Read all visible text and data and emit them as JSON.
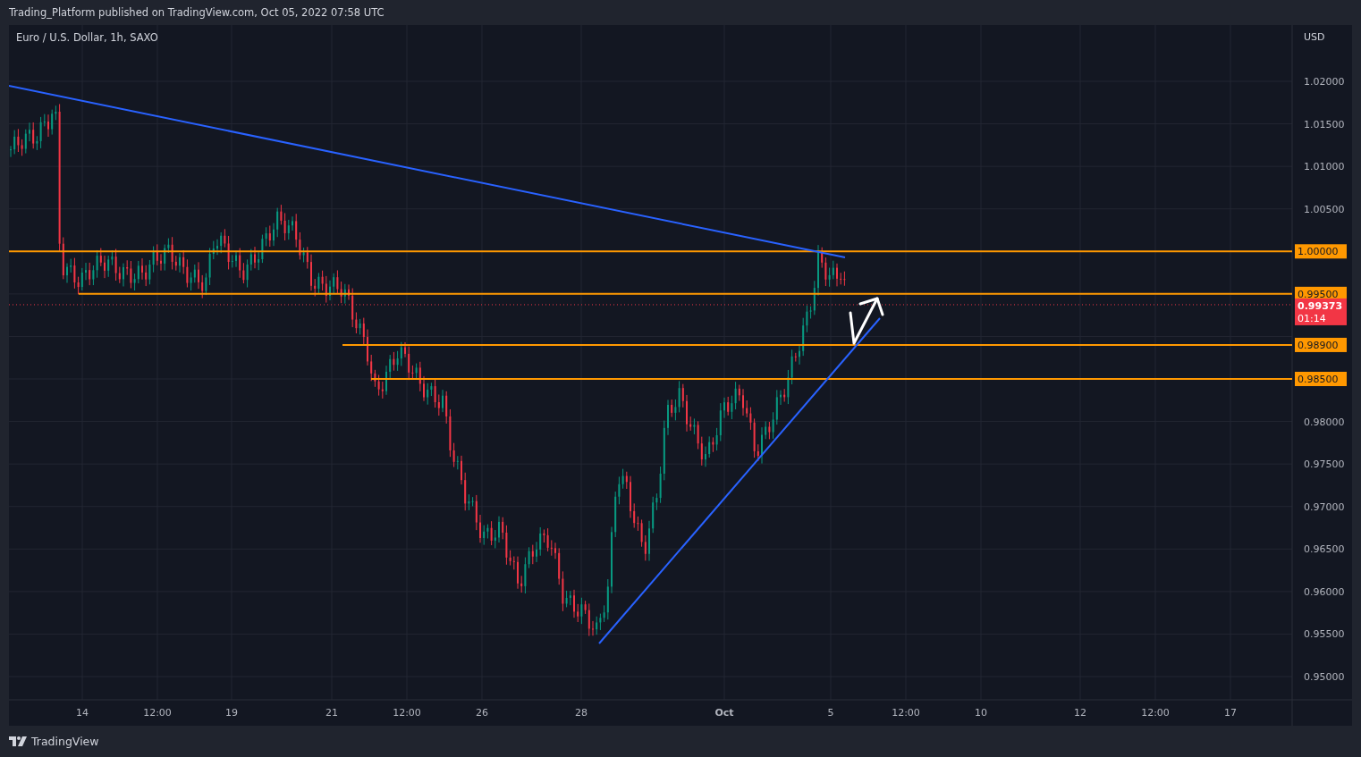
{
  "header": {
    "published_line": "Trading_Platform published on TradingView.com, Oct 05, 2022 07:58 UTC"
  },
  "chart": {
    "symbol_title": "Euro / U.S. Dollar, 1h, SAXO"
  },
  "price_axis": {
    "currency": "USD",
    "ticks": [
      {
        "label": "1.02000"
      },
      {
        "label": "1.01500"
      },
      {
        "label": "1.01000"
      },
      {
        "label": "1.00500"
      },
      {
        "label": "0.98000"
      },
      {
        "label": "0.97500"
      },
      {
        "label": "0.97000"
      },
      {
        "label": "0.96500"
      },
      {
        "label": "0.96000"
      },
      {
        "label": "0.95500"
      },
      {
        "label": "0.95000"
      }
    ],
    "levels": [
      {
        "label": "1.00000"
      },
      {
        "label": "0.99500"
      },
      {
        "label": "0.98900"
      },
      {
        "label": "0.98500"
      }
    ],
    "current_price": {
      "price": "0.99373",
      "countdown": "01:14"
    }
  },
  "time_axis": {
    "ticks": [
      {
        "label": "14",
        "kind": "day"
      },
      {
        "label": "12:00",
        "kind": "time"
      },
      {
        "label": "19",
        "kind": "day"
      },
      {
        "label": "21",
        "kind": "day"
      },
      {
        "label": "12:00",
        "kind": "time"
      },
      {
        "label": "26",
        "kind": "day"
      },
      {
        "label": "28",
        "kind": "day"
      },
      {
        "label": "Oct",
        "kind": "month"
      },
      {
        "label": "5",
        "kind": "day"
      },
      {
        "label": "12:00",
        "kind": "time"
      },
      {
        "label": "10",
        "kind": "day"
      },
      {
        "label": "12",
        "kind": "day"
      },
      {
        "label": "12:00",
        "kind": "time"
      },
      {
        "label": "17",
        "kind": "day"
      }
    ]
  },
  "footer": {
    "brand": "TradingView"
  }
}
